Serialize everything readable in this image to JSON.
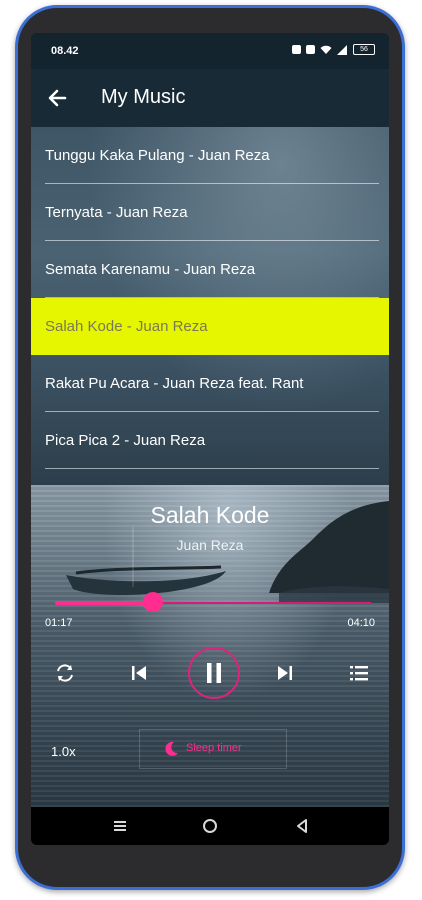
{
  "status_bar": {
    "time": "08.42",
    "battery": "56",
    "icons": [
      "nfc-icon",
      "mute-icon",
      "wifi-icon",
      "signal-icon",
      "battery-icon"
    ]
  },
  "toolbar": {
    "title": "My Music",
    "back_icon": "arrow-left-icon"
  },
  "playlist": [
    {
      "label": "Tunggu Kaka Pulang - Juan Reza",
      "active": false
    },
    {
      "label": "Ternyata - Juan Reza",
      "active": false
    },
    {
      "label": "Semata Karenamu - Juan Reza",
      "active": false
    },
    {
      "label": "Salah Kode - Juan Reza",
      "active": true
    },
    {
      "label": "Rakat Pu Acara - Juan Reza feat. Rant",
      "active": false
    },
    {
      "label": "Pica Pica 2 - Juan Reza",
      "active": false
    }
  ],
  "player": {
    "title": "Salah Kode",
    "artist": "Juan Reza",
    "elapsed": "01:17",
    "duration": "04:10",
    "progress": 0.31,
    "speed": "1.0x",
    "sleep_label": "Sleep timer",
    "controls": [
      "repeat-icon",
      "previous-icon",
      "pause-icon",
      "next-icon",
      "playlist-icon"
    ]
  },
  "colors": {
    "accent": "#ff2d8f",
    "highlight": "#e6f500",
    "toolbar": "#172a35",
    "frame": "#3c6fd6"
  }
}
